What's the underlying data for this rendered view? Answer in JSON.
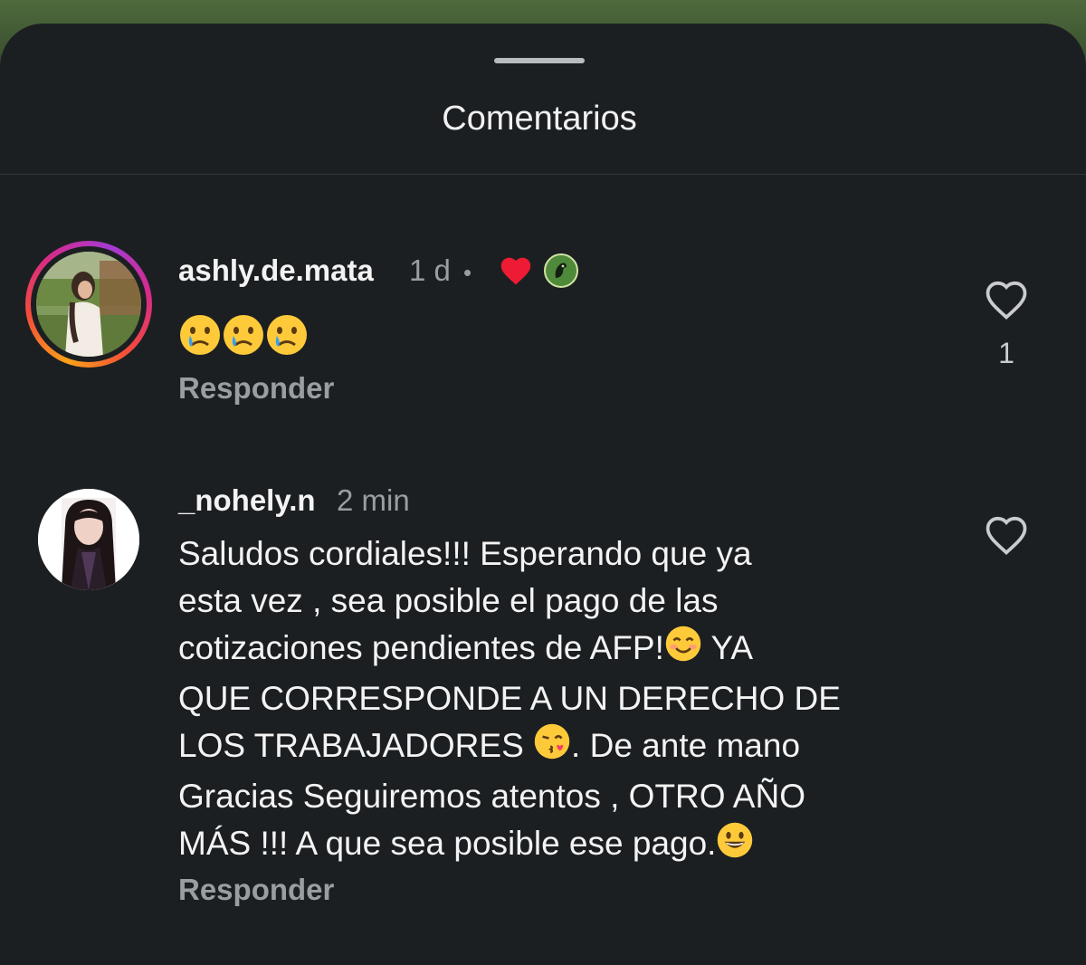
{
  "sheet": {
    "title": "Comentarios"
  },
  "comments": [
    {
      "username": "ashly.de.mata",
      "time": "1 d",
      "separator": "•",
      "badges": [
        "heart-icon",
        "afp-logo-icon"
      ],
      "emojis": [
        "crying-face",
        "crying-face",
        "crying-face"
      ],
      "reply_label": "Responder",
      "like_count": "1",
      "ring_colors": [
        "#f9a21a",
        "#f34b3a",
        "#d82a8a",
        "#a43bd3"
      ]
    },
    {
      "username": "_nohely.n",
      "time": "2 min",
      "text_lines": [
        "Saludos cordiales!!! Esperando que ya",
        "esta vez , sea posible el pago de las",
        "cotizaciones pendientes de AFP!",
        "YA",
        "QUE CORRESPONDE A UN DERECHO DE",
        "LOS TRABAJADORES ",
        ". De ante mano",
        "Gracias Seguiremos atentos , OTRO AÑO",
        "MÁS !!! A que sea posible ese pago."
      ],
      "reply_label": "Responder"
    }
  ],
  "colors": {
    "sheet_bg": "#1c1f22",
    "text": "#f3f3f3",
    "muted": "#9a9ea3",
    "heart_red": "#ed1b33"
  }
}
